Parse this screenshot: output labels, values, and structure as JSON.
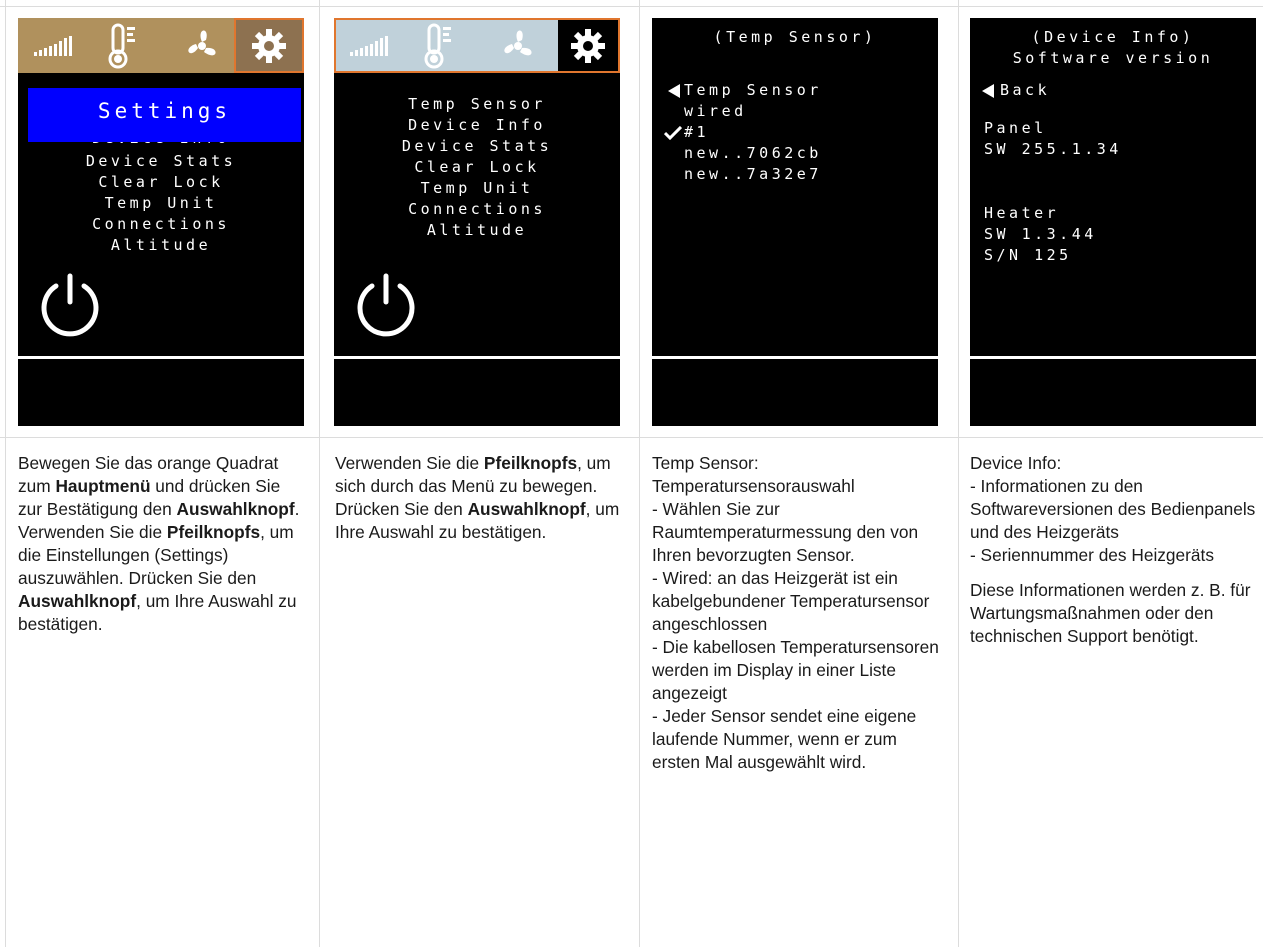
{
  "screens": {
    "s1": {
      "banner": "Settings",
      "partial_item": "Device Info",
      "items": [
        "Device Stats",
        "Clear Lock",
        "Temp Unit",
        "Connections",
        "Altitude"
      ]
    },
    "s2": {
      "items": [
        "Temp Sensor",
        "Device Info",
        "Device Stats",
        "Clear Lock",
        "Temp Unit",
        "Connections",
        "Altitude"
      ]
    },
    "s3": {
      "title": "(Temp Sensor)",
      "lines": [
        "Temp Sensor",
        "wired",
        "#1",
        "new..7062cb",
        "new..7a32e7"
      ]
    },
    "s4": {
      "title": "(Device Info)",
      "subtitle": "Software version",
      "back": "Back",
      "panel_label": "Panel",
      "panel_sw": "SW 255.1.34",
      "heater_label": "Heater",
      "heater_sw": "SW 1.3.44",
      "heater_sn": "S/N 125"
    }
  },
  "descriptions": {
    "c1": {
      "t1": "Bewegen Sie das orange Quadrat zum ",
      "b1": "Hauptmenü",
      "t2": " und drücken Sie zur Bestätigung den ",
      "b2": "Auswahlknopf",
      "t3": ". Verwenden Sie die ",
      "b3": "Pfeilknopfs",
      "t4": ", um die Einstellungen (Settings) auszuwählen. Drücken Sie den ",
      "b4": "Auswahlknopf",
      "t5": ", um Ihre Auswahl zu bestätigen."
    },
    "c2": {
      "t1": "Verwenden Sie die ",
      "b1": "Pfeilknopfs",
      "t2": ", um sich durch das Menü zu bewegen. Drücken Sie den ",
      "b2": "Auswahlknopf",
      "t3": ", um Ihre Auswahl zu bestätigen."
    },
    "c3": {
      "lines": [
        "Temp Sensor:",
        "Temperatursensorauswahl",
        "- Wählen Sie zur Raumtemperaturmessung den von Ihren bevorzugten Sensor.",
        "- Wired: an das Heizgerät ist ein kabelgebundener Temperatursensor angeschlossen",
        "- Die kabellosen Temperatursensoren werden im Display in einer Liste angezeigt",
        "- Jeder Sensor sendet eine eigene laufende Nummer, wenn er zum ersten Mal ausgewählt wird."
      ]
    },
    "c4": {
      "lines": [
        "Device Info:",
        "- Informationen zu den Softwareversionen des Bedienpanels und des Heizgeräts",
        "- Seriennummer des Heizgeräts"
      ],
      "para2": "Diese Informationen werden z. B. für Wartungsmaßnahmen oder den technischen Support benötigt."
    }
  },
  "colors": {
    "iconbar_gold": "#b0915d",
    "iconbar_light": "#c0d1da",
    "selection_orange": "#e0762e",
    "settings_blue": "#0000ff"
  }
}
